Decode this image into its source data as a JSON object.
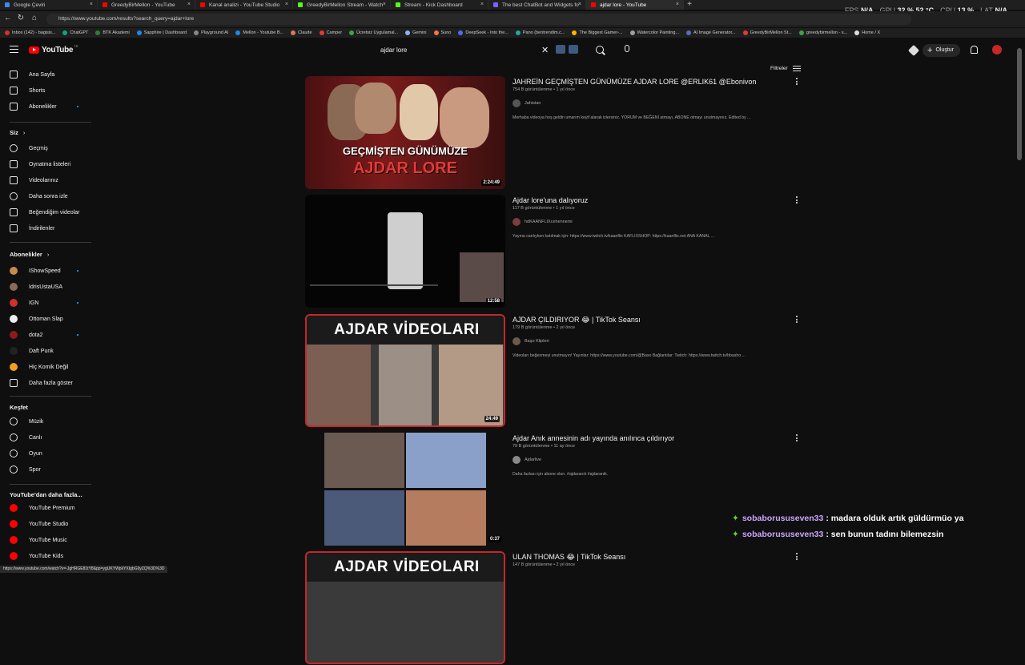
{
  "browser": {
    "tabs": [
      {
        "label": "Google Çeviri",
        "color": "#4285f4",
        "active": false
      },
      {
        "label": "GreedyBirMellon - YouTube",
        "color": "#ff0000",
        "active": false
      },
      {
        "label": "Kanal analizi - YouTube Studio",
        "color": "#ff0000",
        "active": false
      },
      {
        "label": "GreedyBirMellon Stream - Watch",
        "color": "#53fc18",
        "active": false
      },
      {
        "label": "Stream - Kick Dashboard",
        "color": "#53fc18",
        "active": false
      },
      {
        "label": "The best ChatBot and Widgets fo",
        "color": "#7b61ff",
        "active": false
      },
      {
        "label": "ajdar lore - YouTube",
        "color": "#ff0000",
        "active": true
      }
    ],
    "url": "https://www.youtube.com/results?search_query=ajdar+lore",
    "bookmarks": [
      {
        "label": "Inbox (142) - bagisis...",
        "color": "#d93025"
      },
      {
        "label": "ChatGPT",
        "color": "#10a37f"
      },
      {
        "label": "BTK Akademi",
        "color": "#2e7d32"
      },
      {
        "label": "Sapphire | Dashboard",
        "color": "#1e88e5"
      },
      {
        "label": "Playground AI",
        "color": "#888888"
      },
      {
        "label": "Mellon - Youtube B...",
        "color": "#1e88e5"
      },
      {
        "label": "Claude",
        "color": "#d97757"
      },
      {
        "label": "Camper",
        "color": "#e53935"
      },
      {
        "label": "Ücretsiz Uygulamal...",
        "color": "#43a047"
      },
      {
        "label": "Gemini",
        "color": "#8ab4f8"
      },
      {
        "label": "Suno",
        "color": "#ff7043"
      },
      {
        "label": "DeepSeek - Into the...",
        "color": "#4d6bfe"
      },
      {
        "label": "Pano (bentrendim.c...",
        "color": "#26a69a"
      },
      {
        "label": "The Biggest Gamer-...",
        "color": "#ffb300"
      },
      {
        "label": "Watercolor Painting...",
        "color": "#9e9e9e"
      },
      {
        "label": "AI Image Generator...",
        "color": "#5c6bc0"
      },
      {
        "label": "GreedyBirMellon St...",
        "color": "#e53935"
      },
      {
        "label": "greedybirmellon - s...",
        "color": "#43a047"
      },
      {
        "label": "Home / X",
        "color": "#dddddd"
      }
    ],
    "status_url": "https://www.youtube.com/watch?v=-JgHRGE81tY8&pp=ygUKYWpkYXIgbG9yZQ%3D%3D"
  },
  "overlay_stats": {
    "fps_label": "FPS",
    "fps_value": "N/A",
    "gpu_label": "GPU",
    "gpu_value": "32 % 52 °C",
    "cpu_label": "CPU",
    "cpu_value": "13 %",
    "lat_label": "LAT",
    "lat_value": "N/A"
  },
  "header": {
    "logo": "YouTube",
    "logo_country": "TR",
    "search_value": "ajdar lore",
    "create_label": "Oluştur"
  },
  "sidebar": {
    "main": [
      "Ana Sayfa",
      "Shorts",
      "Abonelikler"
    ],
    "you_title": "Siz",
    "you": [
      "Geçmiş",
      "Oynatma listeleri",
      "Videolarınız",
      "Daha sonra izle",
      "Beğendiğim videolar",
      "İndirilenler"
    ],
    "subs_title": "Abonelikler",
    "subs": [
      {
        "label": "IShowSpeed",
        "color": "#c48b4d"
      },
      {
        "label": "IdrisUstaUSA",
        "color": "#8c6a55"
      },
      {
        "label": "IGN",
        "color": "#d32f2f"
      },
      {
        "label": "Ottoman Slap",
        "color": "#eeeeee"
      },
      {
        "label": "dota2",
        "color": "#8e1b1b"
      },
      {
        "label": "Daft Punk",
        "color": "#222222"
      },
      {
        "label": "Hiç Komik Değil",
        "color": "#f0a020"
      }
    ],
    "show_more": "Daha fazla göster",
    "explore_title": "Keşfet",
    "explore": [
      "Müzik",
      "Canlı",
      "Oyun",
      "Spor"
    ],
    "more_title": "YouTube'dan daha fazla...",
    "more": [
      "YouTube Premium",
      "YouTube Studio",
      "YouTube Music",
      "YouTube Kids"
    ]
  },
  "filter_label": "Filtreler",
  "results": [
    {
      "title": "JAHREİN GEÇMİŞTEN GÜNÜMÜZE AJDAR LORE @ERLIK61 @Ebonivon",
      "meta": "754 B görüntülenme • 1 yıl önce",
      "channel": "Jahistan",
      "channel_color": "#555555",
      "desc": "Merhaba videoya hoş geldin umarım keyif alarak izlersiniz. YORUM ve BEĞENİ atmayı, ABONE olmayı unutmayınız. Edited by ...",
      "duration": "2:24:49",
      "thumb_text_1": "GEÇMİŞTEN GÜNÜMÜZE",
      "thumb_text_2": "AJDAR LORE"
    },
    {
      "title": "Ajdar lore'una dalıyoruz",
      "meta": "117 B görüntülenme • 1 yıl önce",
      "channel": "hdKAANFLIXcehennemi",
      "channel_color": "#7a3e3e",
      "desc": "Yayına canlıyken katılmak için: https://www.twitch.tv/kaanflix KAFLIXSHOP: https://kaanflix.net ANA KANAL ...",
      "duration": "12:58"
    },
    {
      "title": "AJDAR ÇILDIRIYOR 😂 | TikTok Seansı",
      "meta": "179 B görüntülenme • 2 yıl önce",
      "channel": "Başo Klipleri",
      "channel_color": "#6b5b4b",
      "desc": "Videoları beğenmeyi unutmayın! Yayınlar: https://www.youtube.com/@Baso Bağlantılar: Twitch: https://www.twitch.tv/bbasho ...",
      "duration": "24:49",
      "thumb_text": "AJDAR VİDEOLARI"
    },
    {
      "title": "Ajdar Anık annesinin adı yayında anılınca çıldırıyor",
      "meta": "79 B görüntülenme • 11 ay önce",
      "channel": "Ajdarlive",
      "channel_color": "#888888",
      "desc": "Daha fazlası için abone olun. #ajdaranık #ajdaranik.",
      "duration": "0:37"
    },
    {
      "title": "ULAN THOMAS 😂 | TikTok Seansı",
      "meta": "147 B görüntülenme • 2 yıl önce",
      "channel": "",
      "channel_color": "#6b5b4b",
      "desc": "",
      "duration": "",
      "thumb_text": "AJDAR VİDEOLARI"
    }
  ],
  "chat": [
    {
      "user": "sobaborususeven33",
      "message": ": madara olduk artık güldürmüo ya"
    },
    {
      "user": "sobaborususeven33",
      "message": ": sen bunun tadını bilemezsin"
    }
  ]
}
